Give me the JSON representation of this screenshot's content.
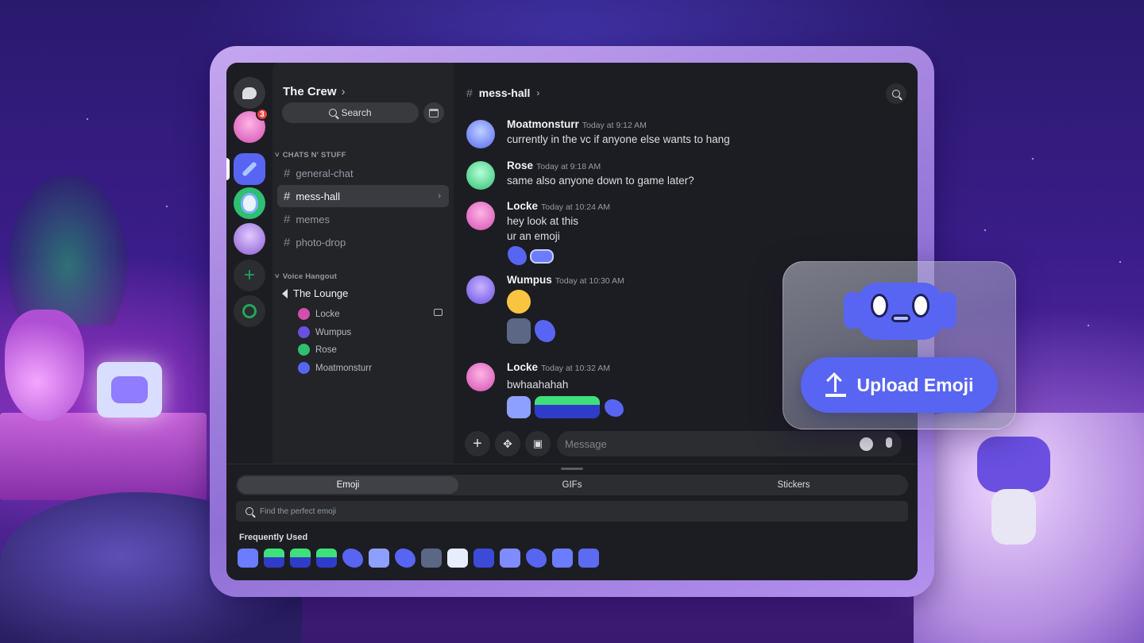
{
  "server": {
    "name": "The Crew",
    "search_label": "Search",
    "badge_count": "3"
  },
  "categories": {
    "text": "CHATS N' STUFF",
    "voice": "Voice Hangout"
  },
  "channels": [
    {
      "label": "general-chat"
    },
    {
      "label": "mess-hall"
    },
    {
      "label": "memes"
    },
    {
      "label": "photo-drop"
    }
  ],
  "voice_channel": {
    "name": "The Lounge",
    "users": [
      {
        "name": "Locke",
        "color": "#d24fb0"
      },
      {
        "name": "Wumpus",
        "color": "#6a4fe0"
      },
      {
        "name": "Rose",
        "color": "#2fbf71"
      },
      {
        "name": "Moatmonsturr",
        "color": "#5865f2"
      }
    ]
  },
  "chat": {
    "channel": "mess-hall",
    "messages": [
      {
        "author": "Moatmonsturr",
        "time": "Today at 9:12 AM",
        "lines": [
          "currently in the vc if anyone else wants to hang"
        ]
      },
      {
        "author": "Rose",
        "time": "Today at 9:18 AM",
        "lines": [
          "same also anyone down to game later?"
        ]
      },
      {
        "author": "Locke",
        "time": "Today at 10:24 AM",
        "lines": [
          "hey look at this",
          "ur an emoji"
        ]
      },
      {
        "author": "Wumpus",
        "time": "Today at 10:30 AM",
        "lines": []
      },
      {
        "author": "Locke",
        "time": "Today at 10:32 AM",
        "lines": [
          "bwhaahahah"
        ]
      }
    ],
    "composer_placeholder": "Message"
  },
  "emoji_picker": {
    "tabs": [
      "Emoji",
      "GIFs",
      "Stickers"
    ],
    "search_placeholder": "Find the perfect emoji",
    "section_title": "Frequently Used"
  },
  "upload_card": {
    "button_label": "Upload Emoji"
  },
  "colors": {
    "blurple": "#5865f2",
    "green": "#23a55a",
    "red": "#f23f43"
  },
  "icons": [
    "chat-bubble-icon",
    "plus-icon",
    "compass-icon",
    "search-icon",
    "calendar-icon",
    "speaker-icon",
    "screen-share-icon",
    "gift-icon",
    "apps-icon",
    "smile-icon",
    "mic-icon",
    "upload-icon"
  ]
}
